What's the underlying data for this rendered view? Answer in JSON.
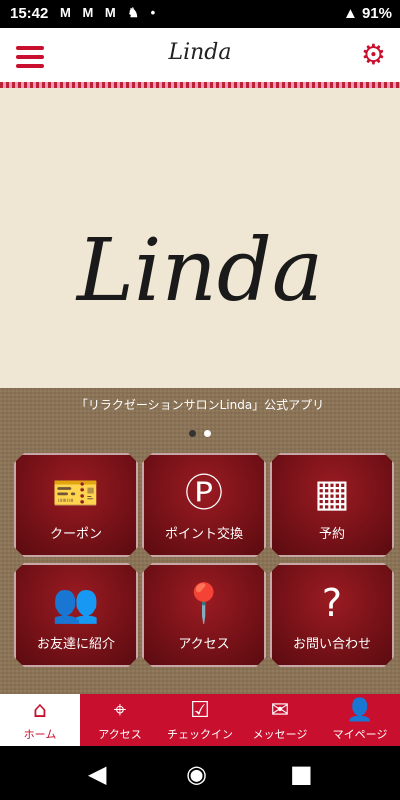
{
  "status": {
    "time": "15:42",
    "battery": "91%"
  },
  "header": {
    "title": "Linda"
  },
  "hero": {
    "logo": "Linda"
  },
  "subtitle": "「リラクゼーションサロンLinda」公式アプリ",
  "tiles": [
    {
      "label": "クーポン",
      "icon": "coupon-icon"
    },
    {
      "label": "ポイント交換",
      "icon": "points-icon"
    },
    {
      "label": "予約",
      "icon": "calendar-icon"
    },
    {
      "label": "お友達に紹介",
      "icon": "friends-icon"
    },
    {
      "label": "アクセス",
      "icon": "location-icon"
    },
    {
      "label": "お問い合わせ",
      "icon": "question-icon"
    }
  ],
  "tabs": [
    {
      "label": "ホーム",
      "icon": "home-icon"
    },
    {
      "label": "アクセス",
      "icon": "location-icon"
    },
    {
      "label": "チェックイン",
      "icon": "checkin-icon"
    },
    {
      "label": "メッセージ",
      "icon": "mail-icon"
    },
    {
      "label": "マイページ",
      "icon": "user-icon"
    }
  ],
  "colors": {
    "accent": "#c8102e",
    "hero_bg": "#efe6d3",
    "tile": "#7a1016"
  }
}
